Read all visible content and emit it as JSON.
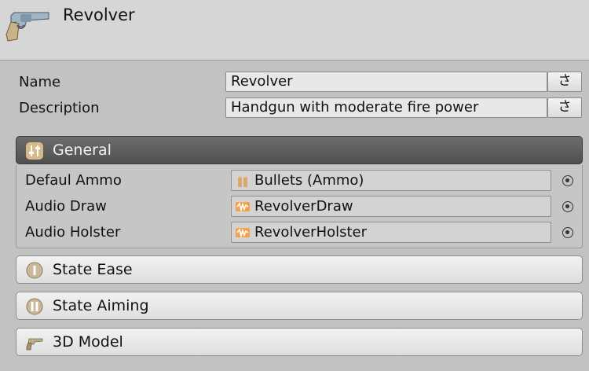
{
  "header": {
    "title": "Revolver",
    "icon": "revolver-icon"
  },
  "fields": {
    "name_label": "Name",
    "name_value": "Revolver",
    "description_label": "Description",
    "description_value": "Handgun with moderate fire power",
    "localize_glyph": "さ"
  },
  "general": {
    "title": "General",
    "icon": "sliders-icon",
    "rows": [
      {
        "label": "Defaul Ammo",
        "value": "Bullets (Ammo)",
        "icon": "bullets-icon"
      },
      {
        "label": "Audio Draw",
        "value": "RevolverDraw",
        "icon": "audio-clip-icon"
      },
      {
        "label": "Audio Holster",
        "value": "RevolverHolster",
        "icon": "audio-clip-icon"
      }
    ]
  },
  "sections": [
    {
      "title": "State Ease",
      "icon": "state-one-icon"
    },
    {
      "title": "State Aiming",
      "icon": "state-two-icon"
    },
    {
      "title": "3D Model",
      "icon": "revolver-small-icon"
    }
  ],
  "colors": {
    "open_section": "#5c5c5c",
    "header_bg": "#d6d6d6",
    "panel_bg": "#c2c2c2"
  }
}
